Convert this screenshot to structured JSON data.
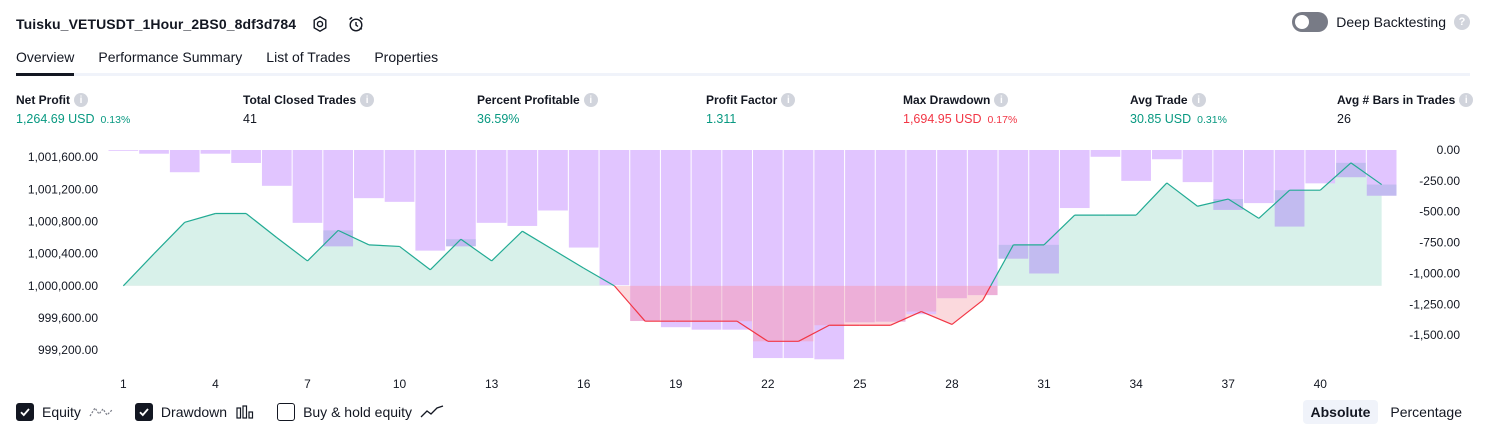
{
  "header": {
    "strategy_name": "Tuisku_VETUSDT_1Hour_2BS0_8df3d784",
    "settings_icon": "gear-icon",
    "alert_icon": "alarm-clock-icon",
    "deep_backtesting_label": "Deep Backtesting",
    "deep_backtesting_on": false,
    "help_glyph": "?"
  },
  "tabs": [
    {
      "label": "Overview",
      "active": true
    },
    {
      "label": "Performance Summary",
      "active": false
    },
    {
      "label": "List of Trades",
      "active": false
    },
    {
      "label": "Properties",
      "active": false
    }
  ],
  "metrics": [
    {
      "label": "Net Profit",
      "value": "1,264.69 USD",
      "pct": "0.13%",
      "tone": "pos"
    },
    {
      "label": "Total Closed Trades",
      "value": "41",
      "pct": "",
      "tone": "neu"
    },
    {
      "label": "Percent Profitable",
      "value": "36.59%",
      "pct": "",
      "tone": "pos"
    },
    {
      "label": "Profit Factor",
      "value": "1.311",
      "pct": "",
      "tone": "pos"
    },
    {
      "label": "Max Drawdown",
      "value": "1,694.95 USD",
      "pct": "0.17%",
      "tone": "neg"
    },
    {
      "label": "Avg Trade",
      "value": "30.85 USD",
      "pct": "0.31%",
      "tone": "pos"
    },
    {
      "label": "Avg # Bars in Trades",
      "value": "26",
      "pct": "",
      "tone": "neu"
    }
  ],
  "colors": {
    "positive": "#089981",
    "negative": "#f23645",
    "equity_line_pos": "#22ab94",
    "equity_line_neg": "#f23645",
    "equity_fill_pos": "#d8f1ea",
    "equity_fill_neg": "#fbd9dd",
    "drawdown_bar": "#dfc2ff",
    "drawdown_overlap": "#aab2e3",
    "axis_text": "#131722"
  },
  "chart_data": {
    "type": "area",
    "x_tick_labels": [
      "1",
      "4",
      "7",
      "10",
      "13",
      "16",
      "19",
      "22",
      "25",
      "28",
      "31",
      "34",
      "37",
      "40"
    ],
    "x": [
      1,
      2,
      3,
      4,
      5,
      6,
      7,
      8,
      9,
      10,
      11,
      12,
      13,
      14,
      15,
      16,
      17,
      18,
      19,
      20,
      21,
      22,
      23,
      24,
      25,
      26,
      27,
      28,
      29,
      30,
      31,
      32,
      33,
      34,
      35,
      36,
      37,
      38,
      39,
      40,
      41,
      42
    ],
    "left_axis": {
      "ticks": [
        "1,001,600.00",
        "1,001,200.00",
        "1,000,800.00",
        "1,000,400.00",
        "1,000,000.00",
        "999,600.00",
        "999,200.00"
      ],
      "range": [
        999040,
        1001690
      ]
    },
    "right_axis": {
      "ticks": [
        "0.00",
        "-250.00",
        "-500.00",
        "-750.00",
        "-1,000.00",
        "-1,250.00",
        "-1,500.00"
      ],
      "range": [
        -1725,
        0
      ]
    },
    "series": [
      {
        "name": "Equity",
        "axis": "left",
        "baseline": 1000000,
        "values": [
          1000000,
          1000400,
          1000790,
          1000900,
          1000900,
          1000600,
          1000310,
          1000690,
          1000510,
          1000490,
          1000200,
          1000580,
          1000310,
          1000680,
          1000450,
          1000220,
          1000000,
          999560,
          999560,
          999560,
          999560,
          999310,
          999310,
          999510,
          999510,
          999510,
          999680,
          999520,
          999820,
          1000510,
          1000510,
          1000880,
          1000880,
          1000880,
          1001280,
          1000990,
          1001080,
          1000840,
          1001190,
          1001190,
          1001530,
          1001260
        ]
      },
      {
        "name": "Drawdown",
        "axis": "right",
        "values": [
          -5,
          -30,
          -180,
          -30,
          -105,
          -290,
          -590,
          -780,
          -390,
          -420,
          -815,
          -780,
          -590,
          -615,
          -490,
          -790,
          -1095,
          -1385,
          -1435,
          -1455,
          -1455,
          -1685,
          -1685,
          -1695,
          -1395,
          -1390,
          -1330,
          -1200,
          -1175,
          -880,
          -1000,
          -470,
          -55,
          -250,
          -75,
          -260,
          -485,
          -430,
          -620,
          -270,
          -220,
          -370
        ]
      }
    ]
  },
  "legend": {
    "items": [
      {
        "label": "Equity",
        "checked": true,
        "icon": "equity-line-icon"
      },
      {
        "label": "Drawdown",
        "checked": true,
        "icon": "drawdown-bars-icon"
      },
      {
        "label": "Buy & hold equity",
        "checked": false,
        "icon": "buy-hold-line-icon"
      }
    ]
  },
  "mode": {
    "absolute_label": "Absolute",
    "percentage_label": "Percentage",
    "active": "absolute"
  }
}
